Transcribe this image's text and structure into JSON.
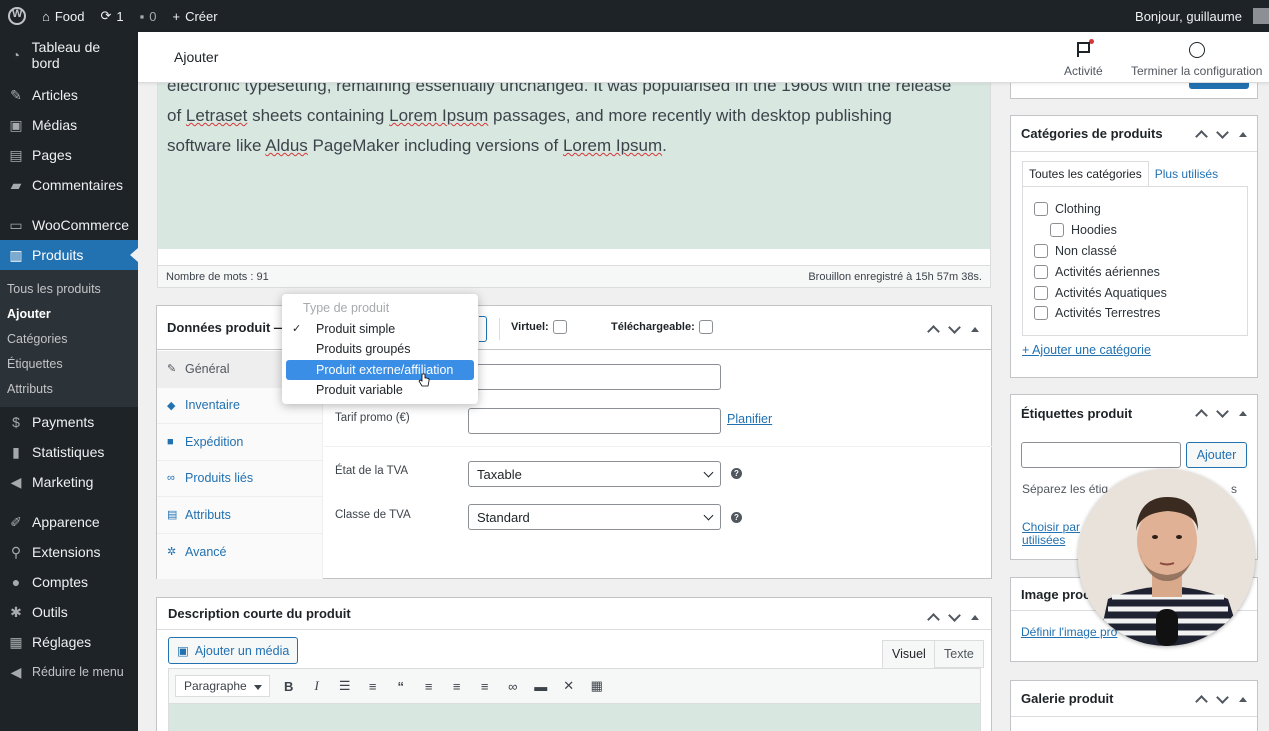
{
  "adminbar": {
    "site_name": "Food",
    "updates_count": "1",
    "comments_count": "0",
    "new_label": "Créer",
    "greeting": "Bonjour, guillaume"
  },
  "sidebar": {
    "items": [
      {
        "label": "Tableau de bord",
        "icon": "dashboard-icon"
      },
      {
        "label": "Articles",
        "icon": "pin-icon"
      },
      {
        "label": "Médias",
        "icon": "media-icon"
      },
      {
        "label": "Pages",
        "icon": "page-icon"
      },
      {
        "label": "Commentaires",
        "icon": "comment-icon"
      },
      {
        "label": "WooCommerce",
        "icon": "woo-icon"
      },
      {
        "label": "Produits",
        "icon": "archive-icon"
      },
      {
        "label": "Payments",
        "icon": "dollar-icon"
      },
      {
        "label": "Statistiques",
        "icon": "chart-icon"
      },
      {
        "label": "Marketing",
        "icon": "megaphone-icon"
      },
      {
        "label": "Apparence",
        "icon": "brush-icon"
      },
      {
        "label": "Extensions",
        "icon": "plugin-icon"
      },
      {
        "label": "Comptes",
        "icon": "user-icon"
      },
      {
        "label": "Outils",
        "icon": "wrench-icon"
      },
      {
        "label": "Réglages",
        "icon": "settings-icon"
      },
      {
        "label": "Réduire le menu",
        "icon": "collapse-icon"
      }
    ],
    "submenu": [
      "Tous les produits",
      "Ajouter",
      "Catégories",
      "Étiquettes",
      "Attributs"
    ]
  },
  "topbar": {
    "title": "Ajouter",
    "activity_label": "Activité",
    "setup_label": "Terminer la configuration"
  },
  "editor": {
    "line1": "electronic typesetting, remaining essentially unchanged. It was popularised in the 1960s with the release",
    "line2_a": "of ",
    "line2_b": "Letraset",
    "line2_c": " sheets containing ",
    "line2_d": "Lorem Ipsum",
    "line2_e": " passages, and more recently with desktop publishing",
    "line3_a": "software like ",
    "line3_b": "Aldus",
    "line3_c": " PageMaker including versions of ",
    "line3_d": "Lorem Ipsum",
    "line3_e": ".",
    "word_count": "Nombre de mots : 91",
    "draft_saved": "Brouillon enregistré à 15h 57m 38s."
  },
  "product_data": {
    "title": "Données produit —",
    "virtual_label": "Virtuel:",
    "downloadable_label": "Téléchargeable:",
    "tabs": [
      "Général",
      "Inventaire",
      "Expédition",
      "Produits liés",
      "Attributs",
      "Avancé"
    ],
    "sale_price_label": "Tarif promo (€)",
    "schedule_link": "Planifier",
    "tax_status_label": "État de la TVA",
    "tax_status_value": "Taxable",
    "tax_class_label": "Classe de TVA",
    "tax_class_value": "Standard"
  },
  "type_dropdown": {
    "header": "Type de produit",
    "options": [
      "Produit simple",
      "Produits groupés",
      "Produit externe/affiliation",
      "Produit variable"
    ],
    "checked": "Produit simple",
    "highlighted": "Produit externe/affiliation"
  },
  "short_description": {
    "title": "Description courte du produit",
    "add_media": "Ajouter un média",
    "visual_tab": "Visuel",
    "text_tab": "Texte",
    "format_select": "Paragraphe"
  },
  "categories_box": {
    "title": "Catégories de produits",
    "tab_all": "Toutes les catégories",
    "tab_popular": "Plus utilisés",
    "items": [
      {
        "label": "Clothing",
        "child": false
      },
      {
        "label": "Hoodies",
        "child": true
      },
      {
        "label": "Non classé",
        "child": false
      },
      {
        "label": "Activités aériennes",
        "child": false
      },
      {
        "label": "Activités Aquatiques",
        "child": false
      },
      {
        "label": "Activités Terrestres",
        "child": false
      }
    ],
    "add_link": "+ Ajouter une catégorie"
  },
  "tags_box": {
    "title": "Étiquettes produit",
    "add_button": "Ajouter",
    "hint": "Séparez les étiq",
    "hint_tail": "s",
    "choose_link_1": "Choisir par",
    "choose_link_2": "utilisées"
  },
  "image_box": {
    "title": "Image proc",
    "set_link": "Définir l'image pro"
  },
  "gallery_box": {
    "title": "Galerie produit"
  }
}
